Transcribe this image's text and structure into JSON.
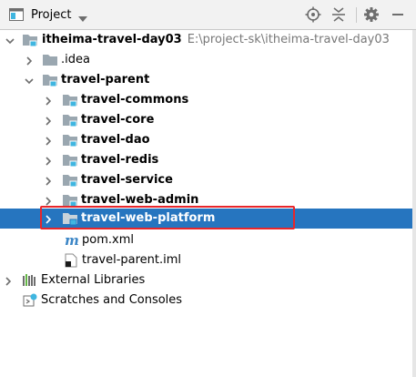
{
  "header": {
    "title": "Project",
    "icons": [
      "project-panel-icon",
      "dropdown-arrow-icon",
      "locate-icon",
      "collapse-all-icon",
      "settings-gear-icon",
      "hide-minus-icon"
    ]
  },
  "tree": {
    "root": {
      "label": "itheima-travel-day03",
      "path": "E:\\project-sk\\itheima-travel-day03"
    },
    "idea": {
      "label": ".idea"
    },
    "parent": {
      "label": "travel-parent"
    },
    "modules": [
      {
        "label": "travel-commons"
      },
      {
        "label": "travel-core"
      },
      {
        "label": "travel-dao"
      },
      {
        "label": "travel-redis"
      },
      {
        "label": "travel-service"
      },
      {
        "label": "travel-web-admin"
      },
      {
        "label": "travel-web-platform"
      }
    ],
    "pom": {
      "label": "pom.xml"
    },
    "iml": {
      "label": "travel-parent.iml"
    },
    "external": {
      "label": "External Libraries"
    },
    "scratches": {
      "label": "Scratches and Consoles"
    }
  },
  "colors": {
    "selection": "#2675bf",
    "highlight_box": "#e8262a",
    "folder": "#9aa7b0",
    "module_marker": "#40b6e0",
    "path_text": "#787878"
  }
}
